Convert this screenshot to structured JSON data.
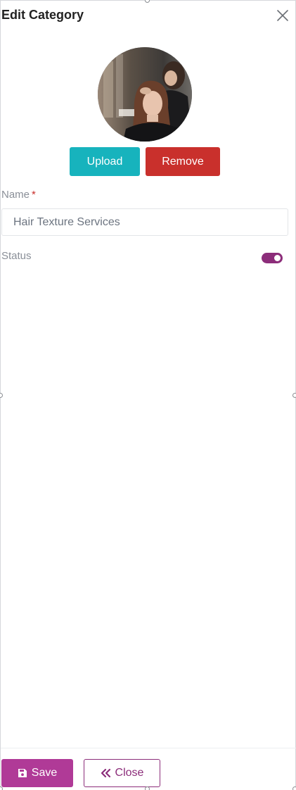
{
  "dialog": {
    "title": "Edit Category",
    "close_icon": "close-icon"
  },
  "image": {
    "description_icon": "category-photo",
    "upload_label": "Upload",
    "remove_label": "Remove"
  },
  "form": {
    "name_label": "Name",
    "name_required_marker": "*",
    "name_value": "Hair Texture Services",
    "status_label": "Status",
    "status_enabled": true
  },
  "footer": {
    "save_label": "Save",
    "save_icon": "floppy-disk-icon",
    "close_label": "Close",
    "close_icon": "double-chevron-left-icon"
  },
  "colors": {
    "upload": "#17b3bd",
    "remove": "#c9302c",
    "primary": "#b03a97",
    "toggle": "#8c2d7a"
  }
}
